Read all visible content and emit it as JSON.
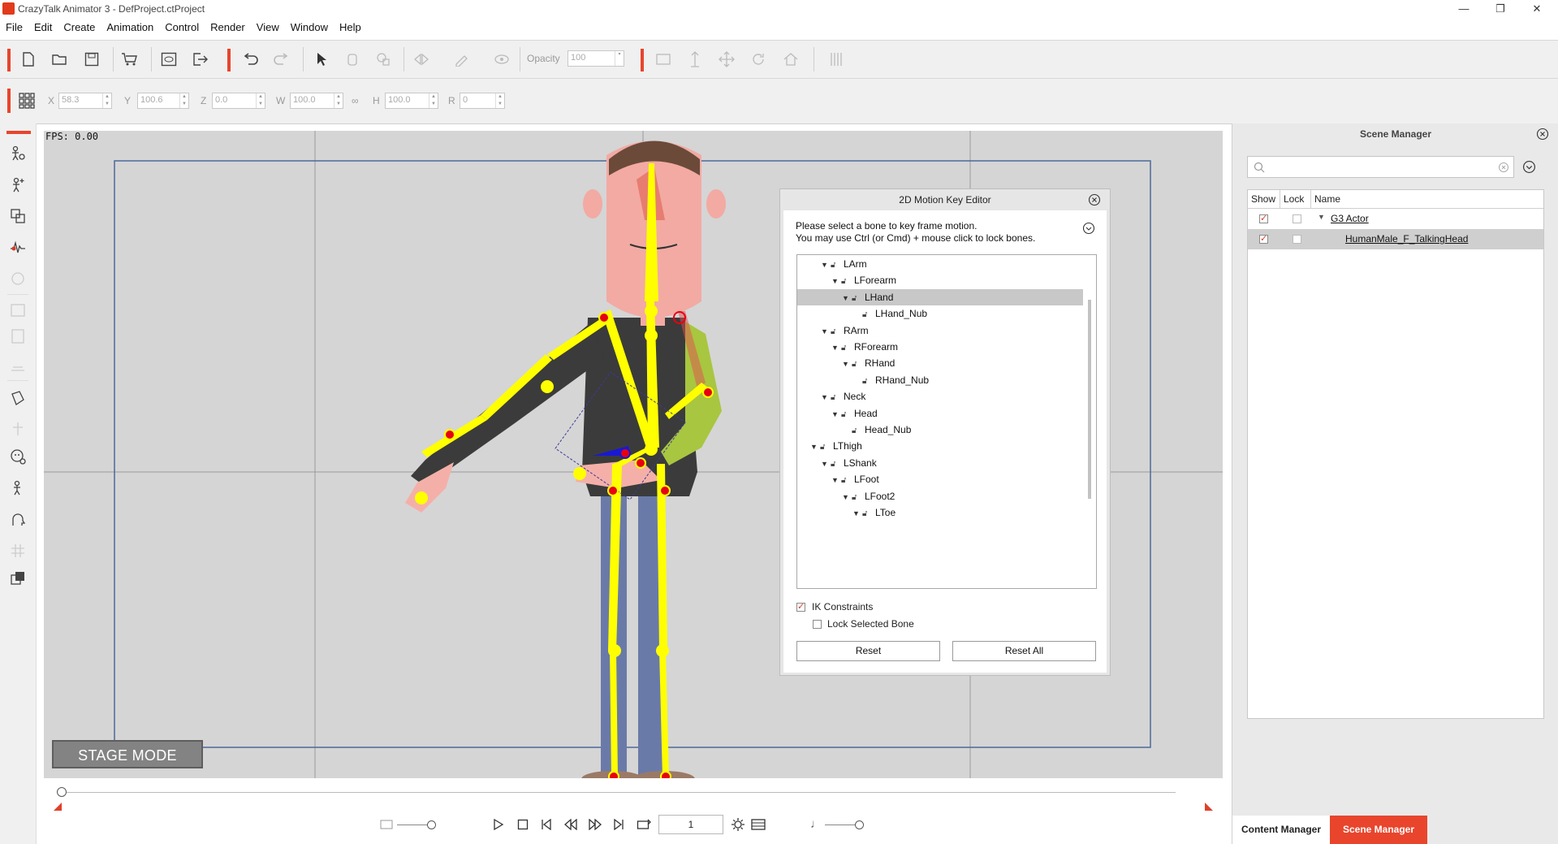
{
  "app": {
    "title": "CrazyTalk Animator 3  - DefProject.ctProject",
    "window_controls": {
      "minimize": "—",
      "restore": "❐",
      "close": "✕"
    }
  },
  "menu": [
    "File",
    "Edit",
    "Create",
    "Animation",
    "Control",
    "Render",
    "View",
    "Window",
    "Help"
  ],
  "toolbar": {
    "opacity_label": "Opacity",
    "opacity_value": "100",
    "icons": [
      "new-icon",
      "open-icon",
      "save-icon",
      "cart-icon",
      "preview-icon",
      "export-icon",
      "undo-icon",
      "redo-icon",
      "select-icon",
      "hand-icon",
      "sprite-icon",
      "flip-icon",
      "brush-icon",
      "eye-icon",
      "layer-icon",
      "move-vertical-icon",
      "move-icon",
      "rotate-icon",
      "home-icon",
      "align-icon"
    ]
  },
  "transform": {
    "x_label": "X",
    "x_value": "58.3",
    "y_label": "Y",
    "y_value": "100.6",
    "z_label": "Z",
    "z_value": "0.0",
    "w_label": "W",
    "w_value": "100.0",
    "h_label": "H",
    "h_value": "100.0",
    "r_label": "R",
    "r_value": "0",
    "link_glyph": "∞"
  },
  "stage": {
    "fps": "FPS: 0.00",
    "mode_button": "STAGE MODE"
  },
  "motion_key_editor": {
    "title": "2D Motion Key Editor",
    "instruction_line1": "Please select a bone to key frame motion.",
    "instruction_line2": "You may use Ctrl (or Cmd) + mouse click to lock bones.",
    "bones": [
      {
        "label": "LArm",
        "depth": 3,
        "expanded": true
      },
      {
        "label": "LForearm",
        "depth": 4,
        "expanded": true
      },
      {
        "label": "LHand",
        "depth": 5,
        "expanded": true,
        "selected": true
      },
      {
        "label": "LHand_Nub",
        "depth": 6,
        "expanded": false
      },
      {
        "label": "RArm",
        "depth": 3,
        "expanded": true
      },
      {
        "label": "RForearm",
        "depth": 4,
        "expanded": true
      },
      {
        "label": "RHand",
        "depth": 5,
        "expanded": true
      },
      {
        "label": "RHand_Nub",
        "depth": 6,
        "expanded": false
      },
      {
        "label": "Neck",
        "depth": 3,
        "expanded": true
      },
      {
        "label": "Head",
        "depth": 4,
        "expanded": true
      },
      {
        "label": "Head_Nub",
        "depth": 5,
        "expanded": false
      },
      {
        "label": "LThigh",
        "depth": 2,
        "expanded": true
      },
      {
        "label": "LShank",
        "depth": 3,
        "expanded": true
      },
      {
        "label": "LFoot",
        "depth": 4,
        "expanded": true
      },
      {
        "label": "LFoot2",
        "depth": 5,
        "expanded": true
      },
      {
        "label": "LToe",
        "depth": 6,
        "expanded": true
      }
    ],
    "ik_constraints_label": "IK Constraints",
    "ik_constraints_checked": true,
    "lock_selected_label": "Lock Selected Bone",
    "lock_selected_checked": false,
    "reset_label": "Reset",
    "reset_all_label": "Reset All"
  },
  "timeline": {
    "current_frame": "1"
  },
  "scene_manager": {
    "title": "Scene Manager",
    "search_placeholder": "",
    "columns": [
      "Show",
      "Lock",
      "Name"
    ],
    "rows": [
      {
        "name": "G3 Actor",
        "show": true,
        "lock": false,
        "expanded": true,
        "selected": false
      },
      {
        "name": "HumanMale_F_TalkingHead",
        "show": true,
        "lock": false,
        "expanded": false,
        "selected": true
      }
    ],
    "tabs": {
      "content": "Content Manager",
      "scene": "Scene Manager"
    }
  },
  "colors": {
    "accent": "#e8452c",
    "bone": "#ffff00",
    "joint": "#e60012"
  }
}
